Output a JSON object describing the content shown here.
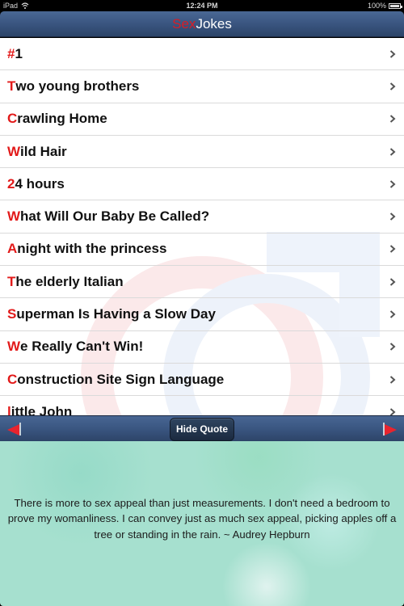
{
  "status_bar": {
    "carrier": "iPad",
    "time": "12:24 PM",
    "battery": "100%"
  },
  "nav_bar": {
    "title_accent": "Sex",
    "title_rest": "Jokes"
  },
  "jokes": [
    {
      "initial": "#",
      "rest": "1"
    },
    {
      "initial": "T",
      "rest": "wo young brothers"
    },
    {
      "initial": "C",
      "rest": "rawling Home"
    },
    {
      "initial": "W",
      "rest": "ild Hair"
    },
    {
      "initial": "2",
      "rest": "4 hours"
    },
    {
      "initial": "W",
      "rest": "hat Will Our Baby Be Called?"
    },
    {
      "initial": "A",
      "rest": " night with the princess"
    },
    {
      "initial": "T",
      "rest": "he elderly Italian"
    },
    {
      "initial": "S",
      "rest": "uperman Is Having a Slow Day"
    },
    {
      "initial": "W",
      "rest": "e Really Can't Win!"
    },
    {
      "initial": "C",
      "rest": "onstruction Site Sign Language"
    },
    {
      "initial": "l",
      "rest": "ittle John"
    }
  ],
  "toolbar": {
    "hide_quote_label": "Hide Quote",
    "prev_icon": "red-left-arrow",
    "next_icon": "red-right-arrow"
  },
  "quote": {
    "text": "There is more to sex appeal than just measurements. I don't need a bedroom to prove my womanliness. I can convey just as much sex appeal, picking apples off a tree or standing in the rain. ~ Audrey Hepburn"
  },
  "colors": {
    "accent_red": "#e21a1a",
    "nav_blue": "#3a5580",
    "quote_green": "#a6e0cf"
  }
}
